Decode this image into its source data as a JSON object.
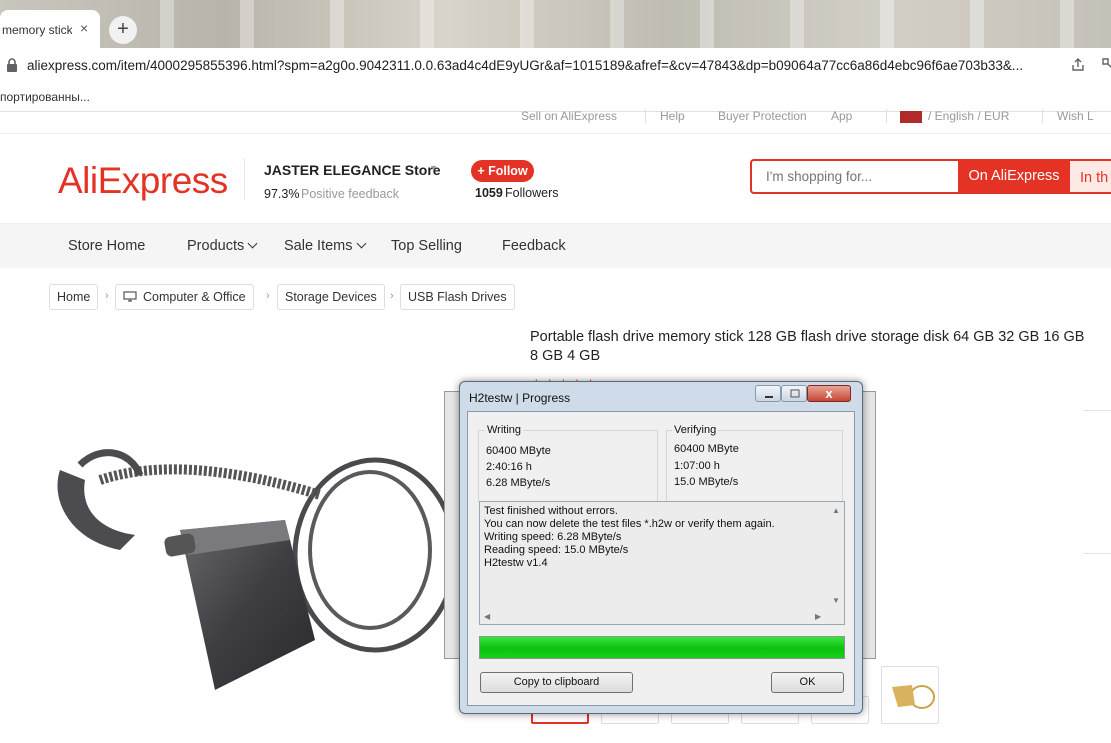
{
  "browser": {
    "tab_title": "memory stick",
    "tab_close": "×",
    "new_tab": "+",
    "url": "aliexpress.com/item/4000295855396.html?spm=a2g0o.9042311.0.0.63ad4c4dE9yUGr&af=1015189&afref=&cv=47843&dp=b09064a77cc6a86d4ebc96f6ae703b33&...",
    "bookmark": "портированны..."
  },
  "topbar": {
    "sell": "Sell on AliExpress",
    "help": "Help",
    "buyer_protection": "Buyer Protection",
    "app": "App",
    "language": "/ English / EUR",
    "wishlist": "Wish L"
  },
  "header": {
    "logo": "AliExpress",
    "store_name": "JASTER ELEGANCE Store",
    "feedback_pct": "97.3%",
    "feedback_label": "Positive feedback",
    "follow_label": "+ Follow",
    "followers_count": "1059",
    "followers_label": "Followers",
    "search_placeholder": "I'm shopping for...",
    "search_ali_label": "On AliExpress",
    "search_store_label": "In th"
  },
  "nav": {
    "items": [
      "Store Home",
      "Products",
      "Sale Items",
      "Top Selling",
      "Feedback"
    ]
  },
  "breadcrumb": [
    "Home",
    "Computer & Office",
    "Storage Devices",
    "USB Flash Drives"
  ],
  "product": {
    "title": "Portable flash drive memory stick 128 GB flash drive storage disk 64 GB 32 GB 16 GB 8 GB 4 GB",
    "stars": "★★★★★"
  },
  "dialog": {
    "title": "H2testw | Progress",
    "close_glyph": "x",
    "writing": {
      "label": "Writing",
      "size": "60400 MByte",
      "time": "2:40:16 h",
      "speed": "6.28 MByte/s"
    },
    "verifying": {
      "label": "Verifying",
      "size": "60400 MByte",
      "time": "1:07:00 h",
      "speed": "15.0 MByte/s"
    },
    "log": [
      "Test finished without errors.",
      "You can now delete the test files *.h2w or verify them again.",
      "Writing speed: 6.28 MByte/s",
      "Reading speed: 15.0 MByte/s",
      "H2testw v1.4"
    ],
    "progress": 1.0,
    "copy_button": "Copy to clipboard",
    "ok_button": "OK"
  },
  "colors": {
    "brand": "#e43225",
    "progress_green": "#0cc10f"
  }
}
